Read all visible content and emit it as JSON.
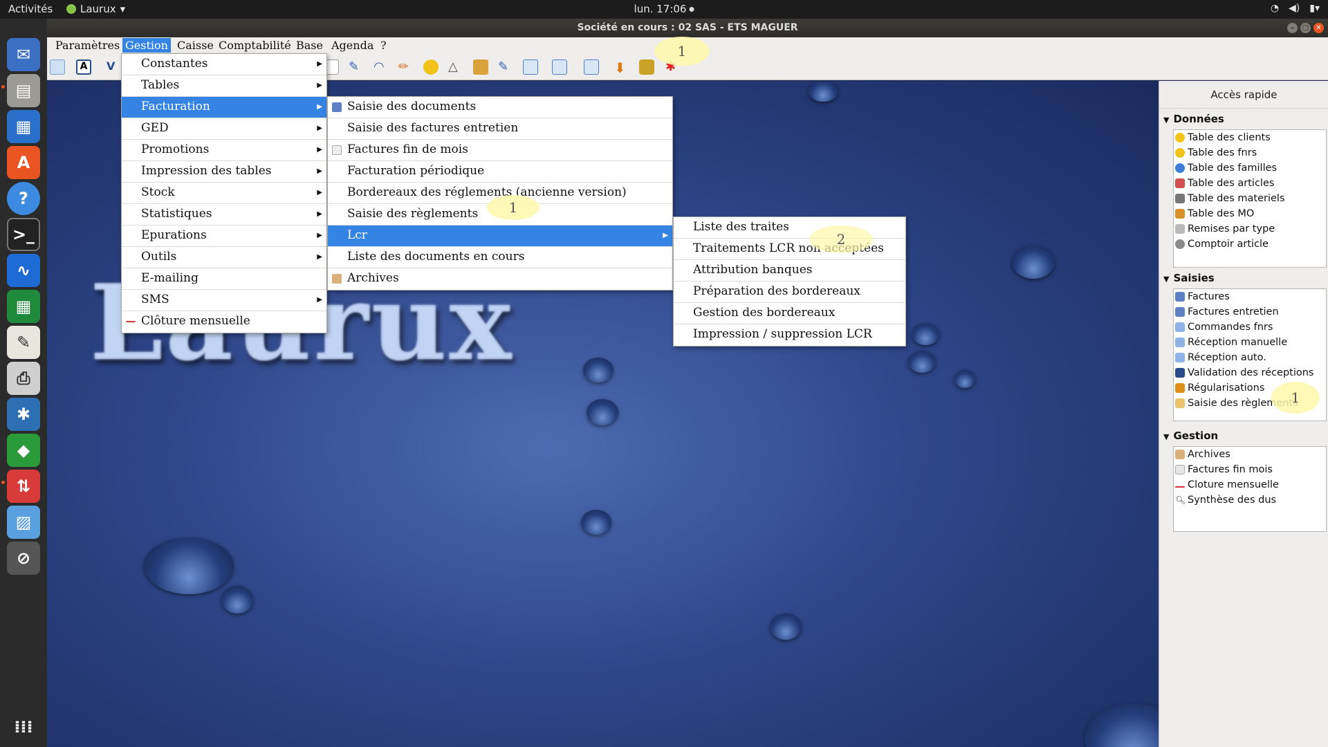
{
  "topbar": {
    "activities": "Activités",
    "app_name": "Laurux",
    "clock": "lun. 17:06",
    "status_icons": [
      "wifi-icon",
      "volume-icon",
      "battery-icon"
    ]
  },
  "window": {
    "title": "Société en cours : 02 SAS - ETS MAGUER"
  },
  "menubar": {
    "items": [
      "Paramètres",
      "Gestion",
      "Caisse",
      "Comptabilité",
      "Base",
      "Agenda",
      "?"
    ],
    "active": "Gestion"
  },
  "gestion_menu": {
    "items": [
      {
        "label": "Constantes",
        "submenu": true
      },
      {
        "label": "Tables",
        "submenu": true
      },
      {
        "label": "Facturation",
        "submenu": true,
        "selected": true
      },
      {
        "label": "GED",
        "submenu": true
      },
      {
        "label": "Promotions",
        "submenu": true
      },
      {
        "label": "Impression des tables",
        "submenu": true
      },
      {
        "label": "Stock",
        "submenu": true
      },
      {
        "label": "Statistiques",
        "submenu": true
      },
      {
        "label": "Epurations",
        "submenu": true
      },
      {
        "label": "Outils",
        "submenu": true
      },
      {
        "label": "E-mailing",
        "submenu": false
      },
      {
        "label": "SMS",
        "submenu": true
      },
      {
        "label": "Clôture mensuelle",
        "submenu": false
      }
    ]
  },
  "facturation_menu": {
    "items": [
      {
        "label": "Saisie des documents"
      },
      {
        "label": "Saisie des factures entretien"
      },
      {
        "label": "Factures fin de mois"
      },
      {
        "label": "Facturation périodique"
      },
      {
        "label": "Bordereaux des réglements (ancienne version)"
      },
      {
        "label": "Saisie des règlements"
      },
      {
        "label": "Lcr",
        "submenu": true,
        "selected": true
      },
      {
        "label": "Liste des documents en cours"
      },
      {
        "label": "Archives"
      }
    ]
  },
  "lcr_menu": {
    "items": [
      {
        "label": "Liste des traites"
      },
      {
        "label": "Traitements LCR non acceptées"
      },
      {
        "label": "Attribution banques"
      },
      {
        "label": "Préparation des bordereaux"
      },
      {
        "label": "Gestion des bordereaux"
      },
      {
        "label": "Impression / suppression LCR"
      }
    ]
  },
  "markers": {
    "toolbar": "1",
    "facturation": "1",
    "lcr": "2",
    "panel": "1"
  },
  "desktop": {
    "logo_text": "Laurux"
  },
  "quick_panel": {
    "title": "Accès rapide",
    "sections": [
      {
        "title": "Données",
        "items": [
          "Table des clients",
          "Table des fnrs",
          "Table des familles",
          "Table des articles",
          "Table des materiels",
          "Table des MO",
          "Remises par type",
          "Comptoir article"
        ]
      },
      {
        "title": "Saisies",
        "items": [
          "Factures",
          "Factures entretien",
          "Commandes fnrs",
          "Réception manuelle",
          "Réception auto.",
          "Validation des réceptions",
          "Régularisations",
          "Saisie des règlements"
        ]
      },
      {
        "title": "Gestion",
        "items": [
          "Archives",
          "Factures fin mois",
          "Cloture mensuelle",
          "Synthèse des dus"
        ]
      }
    ]
  },
  "colors": {
    "selection": "#3584e4",
    "accent": "#e95420",
    "marker": "#fff8aa"
  }
}
